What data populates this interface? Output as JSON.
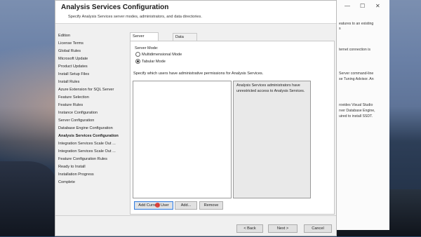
{
  "window": {
    "title": "Analysis Services Configuration",
    "subtitle": "Specify Analysis Services server modes, administrators, and data directories."
  },
  "steps": [
    {
      "label": "Edition",
      "active": false
    },
    {
      "label": "License Terms",
      "active": false
    },
    {
      "label": "Global Rules",
      "active": false
    },
    {
      "label": "Microsoft Update",
      "active": false
    },
    {
      "label": "Product Updates",
      "active": false
    },
    {
      "label": "Install Setup Files",
      "active": false
    },
    {
      "label": "Install Rules",
      "active": false
    },
    {
      "label": "Azure Extension for SQL Server",
      "active": false
    },
    {
      "label": "Feature Selection",
      "active": false
    },
    {
      "label": "Feature Rules",
      "active": false
    },
    {
      "label": "Instance Configuration",
      "active": false
    },
    {
      "label": "Server Configuration",
      "active": false
    },
    {
      "label": "Database Engine Configuration",
      "active": false
    },
    {
      "label": "Analysis Services Configuration",
      "active": true
    },
    {
      "label": "Integration Services Scale Out ...",
      "active": false
    },
    {
      "label": "Integration Services Scale Out ...",
      "active": false
    },
    {
      "label": "Feature Configuration Rules",
      "active": false
    },
    {
      "label": "Ready to Install",
      "active": false
    },
    {
      "label": "Installation Progress",
      "active": false
    },
    {
      "label": "Complete",
      "active": false
    }
  ],
  "tabs": {
    "server_configuration": "Server Configuration",
    "data_directories": "Data Directories"
  },
  "server_mode": {
    "label": "Server Mode:",
    "options": [
      "Multidimensional Mode",
      "Tabular Mode"
    ],
    "selected": "Tabular Mode"
  },
  "admin_hint": "Specify which users have administrative permissions for Analysis Services.",
  "info_text": "Analysis Services administrators have unrestricted access to Analysis Services.",
  "buttons": {
    "add_current_user": "Add Current User",
    "add": "Add...",
    "remove": "Remove",
    "back": "< Back",
    "next": "Next >",
    "cancel": "Cancel"
  },
  "background_window": {
    "controls": [
      "—",
      "☐",
      "✕"
    ],
    "lines": [
      "eatures to an existing",
      "s",
      "",
      "ternet connection is",
      "",
      "",
      "Server command-line",
      "se Tuning Advisor. An",
      "",
      "",
      "rovides Visual Studio",
      "rver Database Engine,",
      "uired to install SSDT."
    ]
  }
}
